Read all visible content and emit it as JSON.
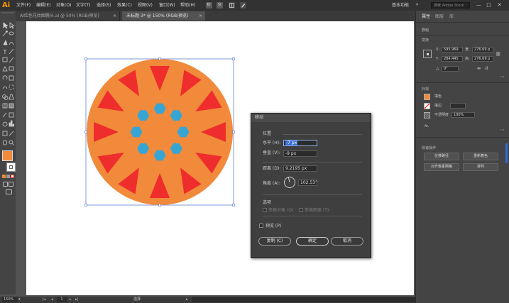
{
  "app": {
    "logo": "Ai"
  },
  "menu": [
    "文件(F)",
    "编辑(E)",
    "对象(O)",
    "文字(T)",
    "选择(S)",
    "效果(C)",
    "视图(V)",
    "窗口(W)",
    "帮助(H)"
  ],
  "menubar_icons": [
    "Br",
    "St"
  ],
  "workspace": "基本功能",
  "search_placeholder": "搜索 Adobe Stock",
  "window_controls": [
    "—",
    "□",
    "✕"
  ],
  "tabs": [
    {
      "label": "AI红色花纹图腾头.ai @ 50% (RGB/预览)",
      "close": "×"
    },
    {
      "label": "未标题-3* @ 150% (RGB/预览)",
      "close": "×"
    }
  ],
  "statusbar": {
    "zoom": "150%",
    "page": "1",
    "tool": "选择"
  },
  "colors": {
    "accent": "#ff9a00",
    "circle_fill": "#f18a3a",
    "triangle_fill": "#ee2d2c",
    "hexagon_fill": "#37a5d4",
    "selection": "#4a6fd6"
  },
  "panel": {
    "tabs": [
      "属性",
      "图层",
      "库"
    ],
    "section_title": "群组",
    "transform": {
      "title": "变换",
      "x_label": "X:",
      "x_value": "595.969",
      "y_label": "Y:",
      "y_value": "284.445",
      "w_label": "宽:",
      "w_value": "276.69 p",
      "h_label": "高:",
      "h_value": "276.69 p",
      "angle_value": "0°"
    },
    "appearance": {
      "title": "外观",
      "fill_label": "填色",
      "stroke_label": "描边",
      "opacity_label": "不透明度",
      "opacity_value": "100%",
      "fx_label": "fx."
    },
    "quick_actions": {
      "title": "快速操作",
      "buttons": [
        "位移路径",
        "重新着色",
        "对齐像素网格",
        "排列"
      ]
    }
  },
  "dialog": {
    "title": "移动",
    "position_section": "位置",
    "horizontal_label": "水平 (H):",
    "horizontal_value": "-7 px",
    "vertical_label": "垂直 (V):",
    "vertical_value": "-9 px",
    "distance_label": "距离 (D):",
    "distance_value": "9.2195 px",
    "angle_label": "角度 (A):",
    "angle_value": "102.53°",
    "options_section": "选项",
    "transform_objects": "变换对象 (O)",
    "transform_patterns": "变换图案 (T)",
    "preview_label": "预览 (P)",
    "copy_button": "复制 (C)",
    "ok_button": "确定",
    "cancel_button": "取消"
  }
}
